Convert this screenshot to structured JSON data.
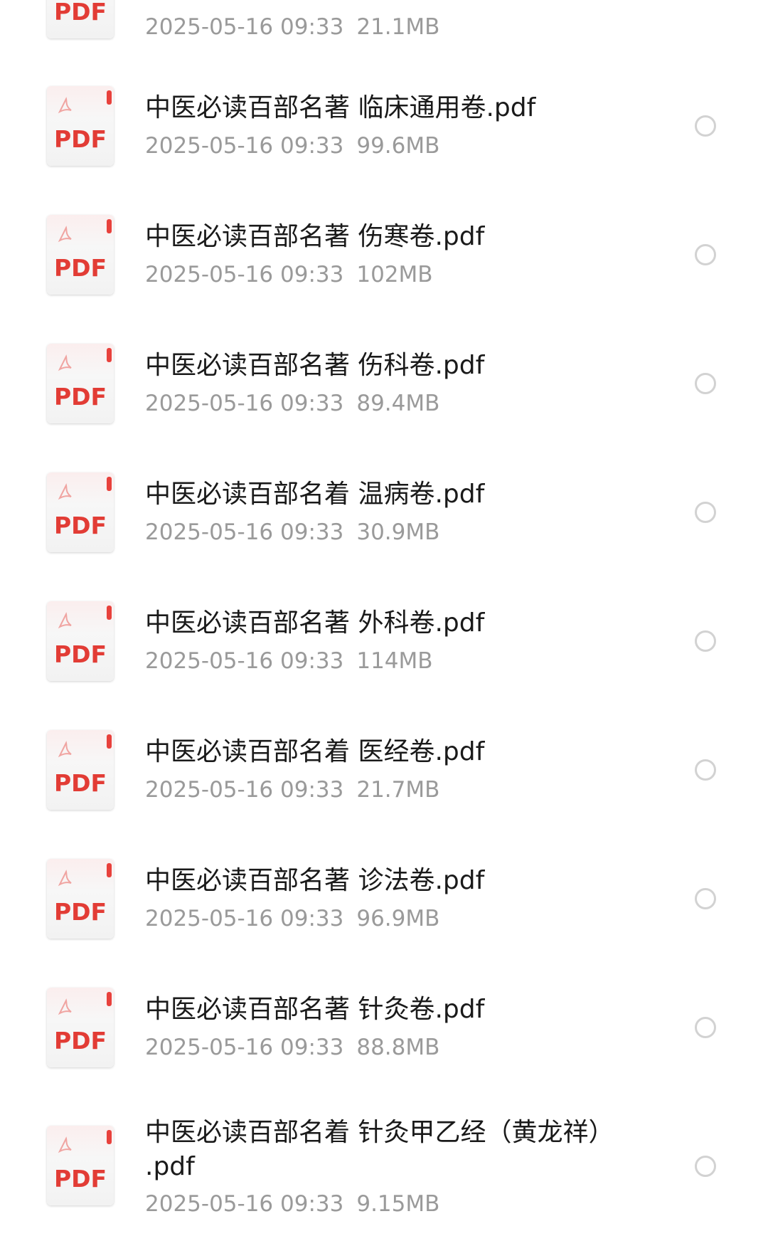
{
  "icon": {
    "name": "pdf-file-icon",
    "label": "PDF",
    "accent_color": "#e23c35"
  },
  "radio_color": "#d2d2d2",
  "files": [
    {
      "name": "",
      "date": "2025-05-16 09:33",
      "size": "21.1MB"
    },
    {
      "name": "中医必读百部名著 临床通用卷.pdf",
      "date": "2025-05-16 09:33",
      "size": "99.6MB"
    },
    {
      "name": "中医必读百部名著 伤寒卷.pdf",
      "date": "2025-05-16 09:33",
      "size": "102MB"
    },
    {
      "name": "中医必读百部名著 伤科卷.pdf",
      "date": "2025-05-16 09:33",
      "size": "89.4MB"
    },
    {
      "name": "中医必读百部名着 温病卷.pdf",
      "date": "2025-05-16 09:33",
      "size": "30.9MB"
    },
    {
      "name": "中医必读百部名著 外科卷.pdf",
      "date": "2025-05-16 09:33",
      "size": "114MB"
    },
    {
      "name": "中医必读百部名着 医经卷.pdf",
      "date": "2025-05-16 09:33",
      "size": "21.7MB"
    },
    {
      "name": "中医必读百部名著 诊法卷.pdf",
      "date": "2025-05-16 09:33",
      "size": "96.9MB"
    },
    {
      "name": "中医必读百部名著 针灸卷.pdf",
      "date": "2025-05-16 09:33",
      "size": "88.8MB"
    },
    {
      "name_line1": "中医必读百部名着 针灸甲乙经（黄龙祥）",
      "name_line2": ".pdf",
      "date": "2025-05-16 09:33",
      "size": "9.15MB"
    }
  ]
}
